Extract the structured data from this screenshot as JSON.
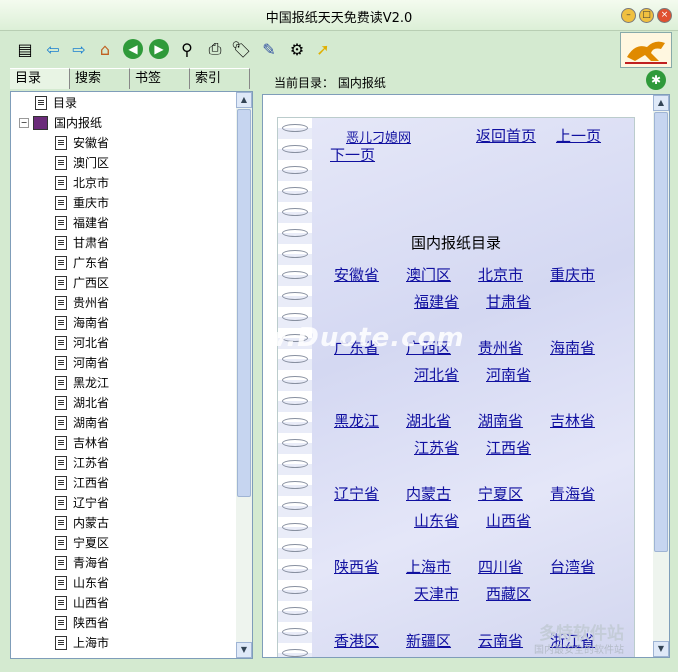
{
  "window": {
    "title": "中国报纸天天免费读V2.0"
  },
  "toolbar_icons": [
    "toc-icon",
    "back-arrow-icon",
    "forward-arrow-icon",
    "home-icon",
    "nav-back-icon",
    "nav-forward-icon",
    "find-icon",
    "print-icon",
    "bookmark-icon",
    "tools-icon",
    "settings-icon",
    "pointer-icon"
  ],
  "tabs": [
    "目录",
    "搜索",
    "书签",
    "索引"
  ],
  "tree": {
    "root": "目录",
    "folder": "国内报纸",
    "items": [
      "安徽省",
      "澳门区",
      "北京市",
      "重庆市",
      "福建省",
      "甘肃省",
      "广东省",
      "广西区",
      "贵州省",
      "海南省",
      "河北省",
      "河南省",
      "黑龙江",
      "湖北省",
      "湖南省",
      "吉林省",
      "江苏省",
      "江西省",
      "辽宁省",
      "内蒙古",
      "宁夏区",
      "青海省",
      "山东省",
      "山西省",
      "陕西省",
      "上海市"
    ]
  },
  "path": {
    "label": "当前目录： 国内报纸"
  },
  "page": {
    "nav": {
      "site": "恶儿刁媳网",
      "home": "返回首页",
      "prev": "上一页",
      "next": "下一页"
    },
    "heading": "国内报纸目录",
    "groups": [
      {
        "row1": [
          "安徽省",
          "澳门区",
          "北京市",
          "重庆市"
        ],
        "row2": [
          "福建省",
          "甘肃省"
        ]
      },
      {
        "row1": [
          "广东省",
          "广西区",
          "贵州省",
          "海南省"
        ],
        "row2": [
          "河北省",
          "河南省"
        ]
      },
      {
        "row1": [
          "黑龙江",
          "湖北省",
          "湖南省",
          "吉林省"
        ],
        "row2": [
          "江苏省",
          "江西省"
        ]
      },
      {
        "row1": [
          "辽宁省",
          "内蒙古",
          "宁夏区",
          "青海省"
        ],
        "row2": [
          "山东省",
          "山西省"
        ]
      },
      {
        "row1": [
          "陕西省",
          "上海市",
          "四川省",
          "台湾省"
        ],
        "row2": [
          "天津市",
          "西藏区"
        ]
      },
      {
        "row1": [
          "香港区",
          "新疆区",
          "云南省",
          "浙江省"
        ],
        "row2": []
      }
    ]
  },
  "watermark": {
    "text": "www.Duote.com",
    "brand": "多特软件站",
    "caption": "国内最安全的软件站"
  }
}
